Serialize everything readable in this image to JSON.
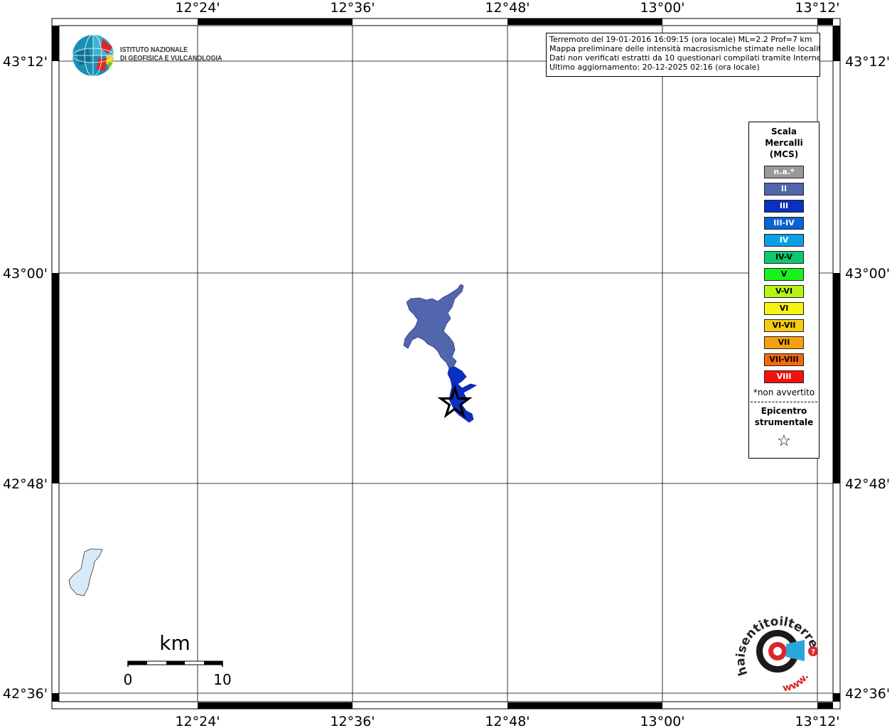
{
  "map": {
    "lon_ticks": [
      "12°24'",
      "12°36'",
      "12°48'",
      "13°00'",
      "13°12'"
    ],
    "lat_ticks": [
      "43°12'",
      "43°00'",
      "42°48'",
      "42°36'"
    ]
  },
  "info_box": {
    "line1": "Terremoto del 19-01-2016 16:09:15 (ora locale) ML=2.2 Prof=7 km",
    "line2": "Mappa preliminare delle intensità macrosismiche stimate nelle località",
    "line3": "Dati non verificati estratti da 10 questionari compilati tramite Internet.",
    "line4": "Ultimo aggiornamento: 20-12-2025 02:16 (ora locale)"
  },
  "logo_ingv": {
    "line1": "ISTITUTO NAZIONALE",
    "line2": "DI GEOFISICA E VULCANOLOGIA"
  },
  "legend": {
    "title_line1": "Scala",
    "title_line2": "Mercalli",
    "title_line3": "(MCS)",
    "items": [
      {
        "label": "n.a.*",
        "color": "#999999",
        "text_color": "#ffffff"
      },
      {
        "label": "II",
        "color": "#5166ad",
        "text_color": "#ffffff"
      },
      {
        "label": "III",
        "color": "#0a2fc2",
        "text_color": "#ffffff"
      },
      {
        "label": "III-IV",
        "color": "#0764d4",
        "text_color": "#ffffff"
      },
      {
        "label": "IV",
        "color": "#0aa0e6",
        "text_color": "#ffffff"
      },
      {
        "label": "IV-V",
        "color": "#0cc970",
        "text_color": "#000000"
      },
      {
        "label": "V",
        "color": "#18f21a",
        "text_color": "#000000"
      },
      {
        "label": "V-VI",
        "color": "#b4f514",
        "text_color": "#000000"
      },
      {
        "label": "VI",
        "color": "#f5f50f",
        "text_color": "#000000"
      },
      {
        "label": "VI-VII",
        "color": "#f5cc0f",
        "text_color": "#000000"
      },
      {
        "label": "VII",
        "color": "#f5a10f",
        "text_color": "#000000"
      },
      {
        "label": "VII-VIII",
        "color": "#f5670f",
        "text_color": "#000000"
      },
      {
        "label": "VIII",
        "color": "#f51010",
        "text_color": "#ffffff"
      }
    ],
    "note": "*non avvertito",
    "epicenter_line1": "Epicentro",
    "epicenter_line2": "strumentale",
    "epicenter_symbol": "☆"
  },
  "scale_bar": {
    "unit": "km",
    "min_label": "0",
    "max_label": "10"
  },
  "logo_hst": {
    "text_main": "haisentitoilterremoto.it",
    "text_www": "www."
  }
}
